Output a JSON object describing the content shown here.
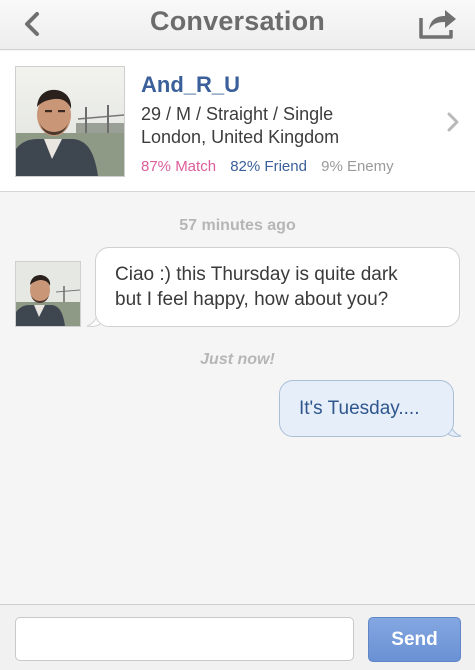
{
  "nav": {
    "title": "Conversation",
    "back_icon": "chevron-left-icon",
    "share_icon": "share-icon"
  },
  "profile": {
    "name": "And_R_U",
    "details_line1": "29 / M / Straight / Single",
    "details_line2": "London, United Kingdom",
    "match": "87% Match",
    "friend": "82% Friend",
    "enemy": "9% Enemy",
    "colors": {
      "name": "#3a5f9a",
      "match": "#dd5c9a",
      "friend": "#3a5f9a",
      "enemy": "#9a9a9a"
    }
  },
  "messages": [
    {
      "timestamp": "57 minutes ago",
      "direction": "incoming",
      "text_line1": "Ciao :) this Thursday is quite dark",
      "text_line2": "but I feel happy, how about you?"
    },
    {
      "timestamp": "Just now!",
      "direction": "outgoing",
      "text": "It's Tuesday...."
    }
  ],
  "composer": {
    "value": "",
    "placeholder": "",
    "send_label": "Send"
  }
}
